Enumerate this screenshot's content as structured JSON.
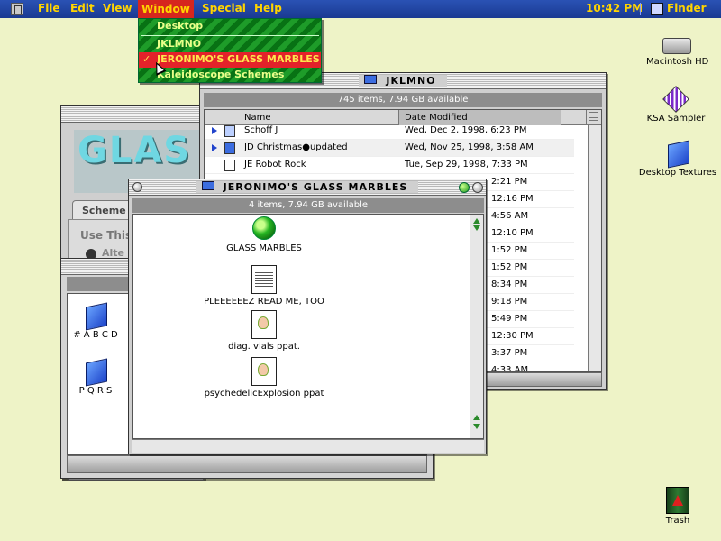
{
  "menubar": {
    "items": [
      "File",
      "Edit",
      "View",
      "Window",
      "Special",
      "Help"
    ],
    "active": "Window",
    "clock": "10:42 PM",
    "app_name": "Finder"
  },
  "window_menu": {
    "items": [
      "Desktop",
      "JKLMNO",
      "JERONIMO'S GLASS MARBLES",
      "Kaleidoscope Schemes"
    ],
    "checked": "JERONIMO'S GLASS MARBLES",
    "check_mark": "✓"
  },
  "desktop_icons": {
    "hd": "Macintosh HD",
    "ksa": "KSA Sampler",
    "textures": "Desktop Textures",
    "trash": "Trash"
  },
  "jklmno_window": {
    "title": "JKLMNO",
    "info": "745 items, 7.94 GB available",
    "col_name": "Name",
    "col_date": "Date Modified",
    "rows": [
      {
        "name": "Schoff J",
        "date": "Wed, Dec 2, 1998, 6:23 PM",
        "icon": "folder-icon",
        "expandable": true
      },
      {
        "name": "JD Christmas●updated",
        "date": "Wed, Nov 25, 1998, 3:58 AM",
        "icon": "folder-icon",
        "expandable": true
      },
      {
        "name": "JE Robot Rock",
        "date": "Tue, Sep 29, 1998, 7:33 PM",
        "icon": "document-icon",
        "expandable": false
      }
    ],
    "partial_dates": [
      "2:21 PM",
      "12:16 PM",
      "4:56 AM",
      "12:10 PM",
      "1:52 PM",
      "1:52 PM",
      "8:34 PM",
      "9:18 PM",
      "5:49 PM",
      "12:30 PM",
      "3:37 PM",
      "4:33 AM"
    ]
  },
  "glass_marbles_window": {
    "title": "JERONIMO'S GLASS MARBLES",
    "info": "4 items, 7.94 GB available",
    "items": [
      {
        "name": "GLASS MARBLES",
        "icon": "green-marble-icon"
      },
      {
        "name": "PLEEEEEEZ READ ME, TOO",
        "icon": "newspaper-document-icon"
      },
      {
        "name": "diag. vials ppat.",
        "icon": "kaleidoscope-document-icon"
      },
      {
        "name": "psychedelicExplosion ppat",
        "icon": "kaleidoscope-document-icon"
      }
    ]
  },
  "kaleidoscope_window": {
    "logo_text": "GLAS",
    "tab_label": "Scheme",
    "option_label": "Use This",
    "radio_label": "Alte"
  },
  "abcd_window": {
    "items": [
      "# A B C D",
      "P Q R S"
    ]
  }
}
